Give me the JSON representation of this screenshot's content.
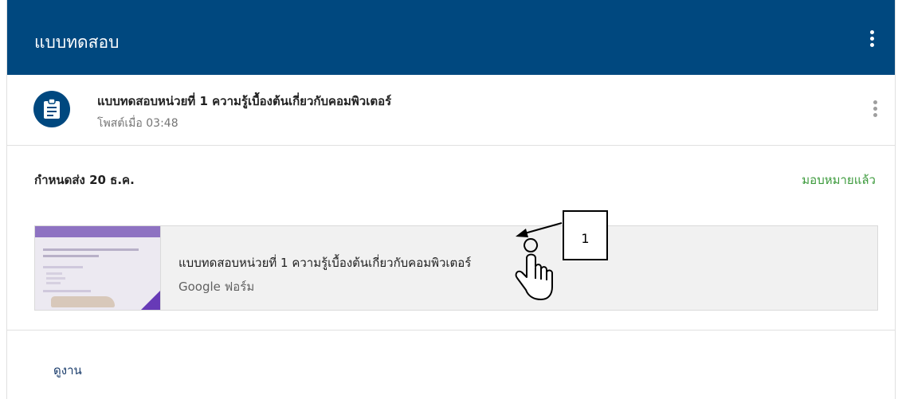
{
  "header": {
    "title": "แบบทดสอบ",
    "bg_color": "#00487f",
    "menu_icon": "more-vert-icon"
  },
  "post": {
    "icon": "assignment-icon",
    "title": "แบบทดสอบหน่วยที่ 1 ความรู้เบื้องต้นเกี่ยวกับคอมพิวเตอร์",
    "posted": "โพสต์เมื่อ 03:48",
    "menu_icon": "more-vert-icon"
  },
  "assignment": {
    "due": "กำหนดส่ง 20 ธ.ค.",
    "status": "มอบหมายแล้ว",
    "status_color": "#3c9a3c"
  },
  "attachment": {
    "title": "แบบทดสอบหน่วยที่ 1 ความรู้เบื้องต้นเกี่ยวกับคอมพิวเตอร์",
    "type": "Google ฟอร์ม",
    "thumbnail_accent": "#673ab7"
  },
  "footer": {
    "view_label": "ดูงาน"
  },
  "annotation": {
    "label": "1",
    "cursor_icon": "hand-pointer-icon"
  }
}
